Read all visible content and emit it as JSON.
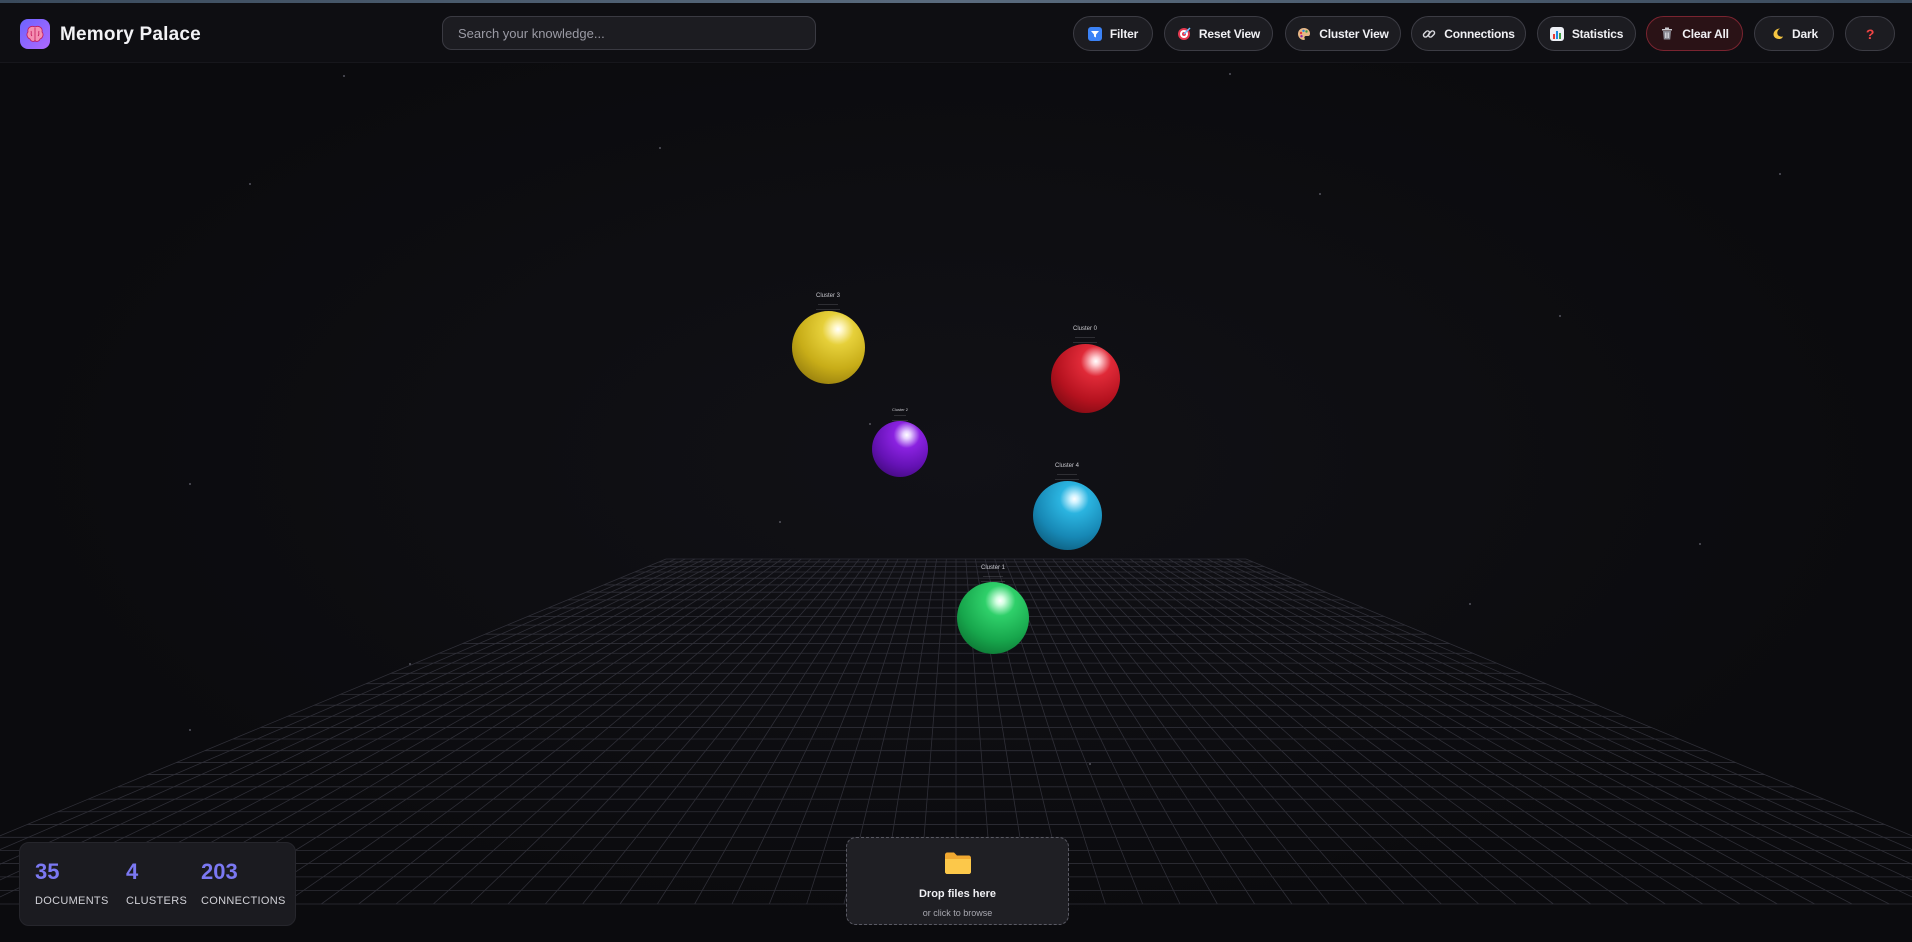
{
  "header": {
    "logo_icon": "brain-icon",
    "title": "Memory Palace",
    "search": {
      "placeholder": "Search your knowledge...",
      "value": ""
    },
    "buttons": [
      {
        "id": "filter",
        "icon": "filter-icon",
        "label": "Filter"
      },
      {
        "id": "reset-view",
        "icon": "target-icon",
        "label": "Reset View"
      },
      {
        "id": "cluster-view",
        "icon": "palette-icon",
        "label": "Cluster View"
      },
      {
        "id": "connections",
        "icon": "link-icon",
        "label": "Connections"
      },
      {
        "id": "statistics",
        "icon": "bar-chart-icon",
        "label": "Statistics"
      },
      {
        "id": "clear-all",
        "icon": "trash-icon",
        "label": "Clear All"
      },
      {
        "id": "theme",
        "icon": "moon-icon",
        "label": "Dark"
      },
      {
        "id": "help",
        "icon": "question-icon",
        "label": ""
      }
    ]
  },
  "scene": {
    "clusters": [
      {
        "name": "Cluster 3",
        "color": "#d9c12a"
      },
      {
        "name": "Cluster 0",
        "color": "#d8202e"
      },
      {
        "name": "Cluster 2",
        "color": "#7a18d0"
      },
      {
        "name": "Cluster 4",
        "color": "#1fa6d6"
      },
      {
        "name": "Cluster 1",
        "color": "#22c55e"
      }
    ]
  },
  "stats": {
    "documents": {
      "value": "35",
      "label": "DOCUMENTS"
    },
    "clusters": {
      "value": "4",
      "label": "CLUSTERS"
    },
    "connections": {
      "value": "203",
      "label": "CONNECTIONS"
    }
  },
  "dropzone": {
    "icon": "folder-icon",
    "title": "Drop files here",
    "hint": "or click to browse"
  }
}
